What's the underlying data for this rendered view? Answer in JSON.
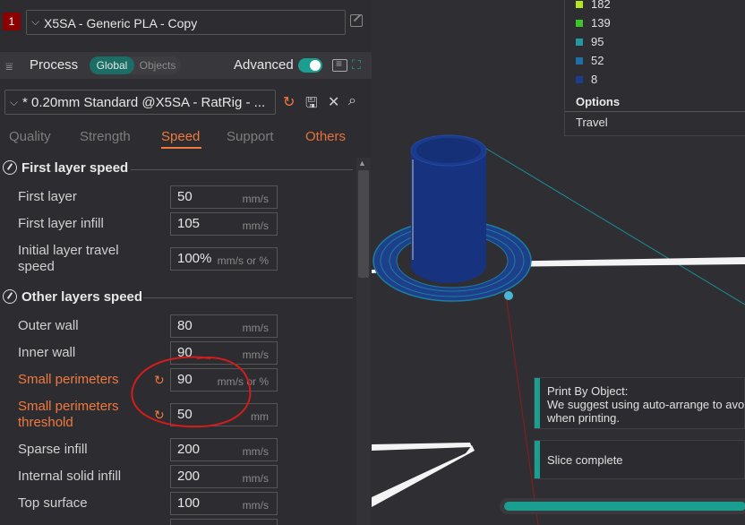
{
  "filament": {
    "index": "1",
    "name": "X5SA - Generic PLA - Copy"
  },
  "process": {
    "title": "Process",
    "toggle_global": "Global",
    "toggle_objects": "Objects",
    "advanced_label": "Advanced",
    "advanced_on": true
  },
  "preset": {
    "name": "* 0.20mm Standard @X5SA - RatRig - ..."
  },
  "tabs": [
    "Quality",
    "Strength",
    "Speed",
    "Support",
    "Others"
  ],
  "active_tab": "Speed",
  "sections": {
    "first_layer": "First layer speed",
    "other_layers": "Other layers speed"
  },
  "rows": [
    {
      "label": "First layer",
      "value": "50",
      "unit": "mm/s"
    },
    {
      "label": "First layer infill",
      "value": "105",
      "unit": "mm/s"
    },
    {
      "label": "Initial layer travel",
      "label2": "speed",
      "value": "100%",
      "unit": "mm/s or %"
    },
    {
      "label": "Outer wall",
      "value": "80",
      "unit": "mm/s"
    },
    {
      "label": "Inner wall",
      "value": "90",
      "unit": "mm/s"
    },
    {
      "label": "Small perimeters",
      "value": "90",
      "unit": "mm/s or %",
      "modified": true
    },
    {
      "label": "Small perimeters",
      "label2": "threshold",
      "value": "50",
      "unit": "mm",
      "modified": true
    },
    {
      "label": "Sparse infill",
      "value": "200",
      "unit": "mm/s"
    },
    {
      "label": "Internal solid infill",
      "value": "200",
      "unit": "mm/s"
    },
    {
      "label": "Top surface",
      "value": "100",
      "unit": "mm/s"
    }
  ],
  "legend": {
    "items": [
      {
        "value": "182",
        "color": "#b5e61d"
      },
      {
        "value": "139",
        "color": "#3cc42b"
      },
      {
        "value": "95",
        "color": "#1e9aa0"
      },
      {
        "value": "52",
        "color": "#1d6fa8"
      },
      {
        "value": "8",
        "color": "#1a3d8f"
      }
    ],
    "options_title": "Options",
    "option_travel": "Travel"
  },
  "notifications": {
    "print_by_object_title": "Print By Object:",
    "print_by_object_line1": "We suggest using auto-arrange to avo",
    "print_by_object_line2": "when printing.",
    "slice_complete": "Slice complete"
  },
  "progress": 1.0,
  "colors": {
    "accent": "#f0793e",
    "teal": "#1a9e90",
    "annotation_red": "#d31c1c"
  }
}
